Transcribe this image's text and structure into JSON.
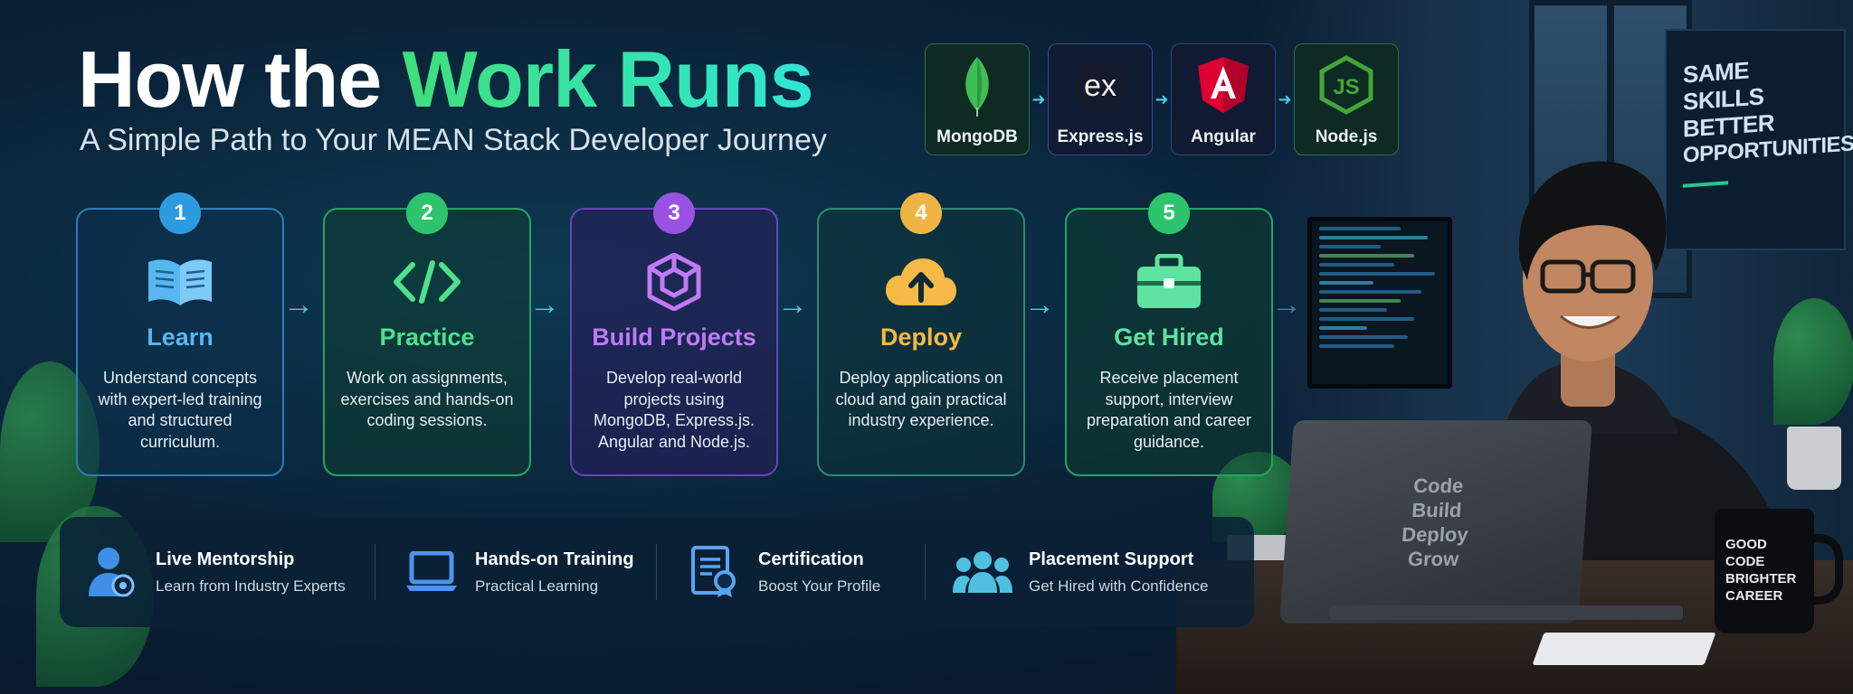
{
  "header": {
    "title_part1": "How the ",
    "title_part2": "Work Runs",
    "subtitle": "A Simple Path to Your MEAN Stack Developer Journey"
  },
  "tech_stack": [
    {
      "name": "MongoDB",
      "icon": "leaf-icon",
      "color": "#2a6b3e"
    },
    {
      "name": "Express.js",
      "icon": "ex-icon",
      "color": "#3d4d9c"
    },
    {
      "name": "Angular",
      "icon": "angular-shield-icon",
      "color": "#dd0031"
    },
    {
      "name": "Node.js",
      "icon": "nodejs-hex-icon",
      "color": "#44a538"
    }
  ],
  "tech_glyphs": {
    "express": "ex",
    "node": "JS"
  },
  "steps": [
    {
      "number": "1",
      "title": "Learn",
      "icon": "open-book-icon",
      "color": "#3ba7ea",
      "description": "Understand concepts with expert-led training and structured curriculum."
    },
    {
      "number": "2",
      "title": "Practice",
      "icon": "code-brackets-icon",
      "color": "#35d07a",
      "description": "Work on assignments, exercises and hands-on coding sessions."
    },
    {
      "number": "3",
      "title": "Build Projects",
      "icon": "cube-icon",
      "color": "#a25be8",
      "description": "Develop real-world projects using MongoDB, Express.js. Angular and Node.js."
    },
    {
      "number": "4",
      "title": "Deploy",
      "icon": "cloud-upload-icon",
      "color": "#f2b64a",
      "description": "Deploy applications on cloud and gain practical industry experience."
    },
    {
      "number": "5",
      "title": "Get Hired",
      "icon": "briefcase-icon",
      "color": "#37d18a",
      "description": "Receive placement support, interview preparation and career guidance."
    }
  ],
  "features": [
    {
      "title": "Live Mentorship",
      "subtitle": "Learn from Industry Experts",
      "icon": "mentor-icon"
    },
    {
      "title": "Hands-on Training",
      "subtitle": "Practical Learning",
      "icon": "laptop-icon"
    },
    {
      "title": "Certification",
      "subtitle": "Boost Your Profile",
      "icon": "certificate-icon"
    },
    {
      "title": "Placement Support",
      "subtitle": "Get Hired with Confidence",
      "icon": "team-icon"
    }
  ],
  "poster": {
    "lines": [
      "SAME",
      "SKILLS",
      "BETTER",
      "OPPORTUNITIES"
    ]
  },
  "laptop": {
    "lines": [
      "Code",
      "Build",
      "Deploy",
      "Grow"
    ]
  },
  "mug": {
    "lines": [
      "GOOD",
      "CODE",
      "BRIGHTER",
      "CAREER"
    ]
  }
}
